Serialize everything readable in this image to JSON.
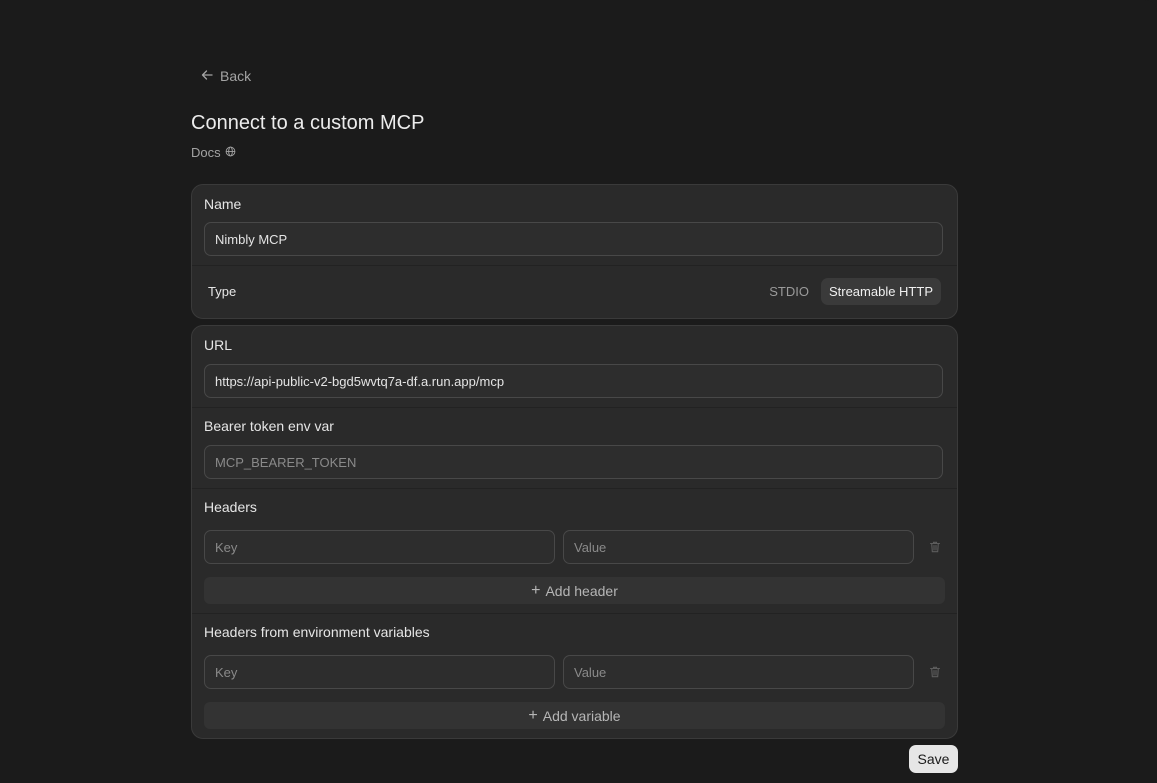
{
  "nav": {
    "back_label": "Back"
  },
  "header": {
    "title": "Connect to a custom MCP",
    "docs_label": "Docs"
  },
  "basic": {
    "name_label": "Name",
    "name_value": "Nimbly MCP",
    "type_label": "Type",
    "type_options": [
      "STDIO",
      "Streamable HTTP"
    ],
    "type_selected": "Streamable HTTP"
  },
  "http": {
    "url_label": "URL",
    "url_value": "https://api-public-v2-bgd5wvtq7a-df.a.run.app/mcp",
    "bearer_label": "Bearer token env var",
    "bearer_placeholder": "MCP_BEARER_TOKEN",
    "headers_label": "Headers",
    "headers_key_placeholder": "Key",
    "headers_value_placeholder": "Value",
    "add_header_label": "Add header",
    "env_headers_label": "Headers from environment variables",
    "env_key_placeholder": "Key",
    "env_value_placeholder": "Value",
    "add_variable_label": "Add variable"
  },
  "footer": {
    "save_label": "Save"
  },
  "colors": {
    "background": "#1b1b1b",
    "card": "#2a2a2a",
    "active_segment": "#3a3a3a",
    "save_button": "#e6e6e6"
  },
  "icons": {
    "back": "arrow-left-icon",
    "docs": "globe-icon",
    "trash": "trash-icon",
    "plus": "plus-icon"
  }
}
